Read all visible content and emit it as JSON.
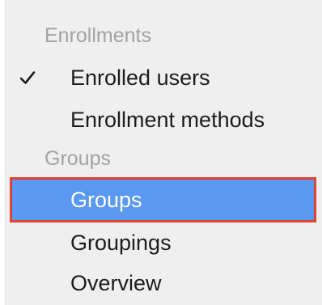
{
  "menu": {
    "sections": [
      {
        "header": "Enrollments",
        "items": [
          {
            "label": "Enrolled users",
            "checked": true
          },
          {
            "label": "Enrollment methods",
            "checked": false
          }
        ]
      },
      {
        "header": "Groups",
        "items": [
          {
            "label": "Groups",
            "checked": false,
            "highlighted": true
          },
          {
            "label": "Groupings",
            "checked": false
          },
          {
            "label": "Overview",
            "checked": false
          }
        ]
      }
    ],
    "check_icon": "checkmark-icon",
    "colors": {
      "menu_background": "#efefef",
      "header_text": "#a3a3a3",
      "item_text": "#1c1c1c",
      "highlight_background": "#5a98f2",
      "highlight_text": "#ffffff",
      "highlight_outline": "#e0442f"
    }
  }
}
